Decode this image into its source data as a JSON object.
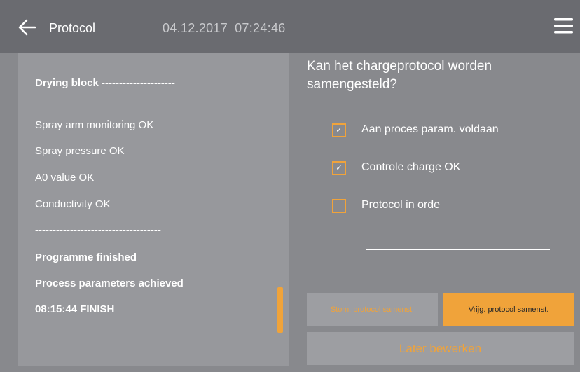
{
  "header": {
    "title": "Protocol",
    "date": "04.12.2017",
    "time": "07:24:46",
    "back_icon": "arrow-left-icon",
    "menu_icon": "hamburger-menu-icon"
  },
  "log": {
    "lines": [
      {
        "text": "Drying block ---------------------",
        "bold": true
      },
      {
        "text": "Spray arm monitoring OK",
        "bold": false
      },
      {
        "text": "Spray pressure OK",
        "bold": false
      },
      {
        "text": "A0 value OK",
        "bold": false
      },
      {
        "text": "Conductivity OK",
        "bold": false
      },
      {
        "text": "------------------------------------",
        "bold": true
      },
      {
        "text": "Programme finished",
        "bold": true
      },
      {
        "text": "Process parameters achieved",
        "bold": true
      },
      {
        "text": "08:15:44 FINISH",
        "bold": true
      }
    ]
  },
  "question": "Kan het chargeprotocol worden samengesteld?",
  "checklist": [
    {
      "label": "Aan proces param. voldaan",
      "checked": true
    },
    {
      "label": "Controle charge OK",
      "checked": true
    },
    {
      "label": "Protocol in orde",
      "checked": false
    }
  ],
  "buttons": {
    "storn": "Storn. protocol samenst.",
    "vrijg": "Vrijg. protocol samenst.",
    "later": "Later bewerken"
  },
  "colors": {
    "accent": "#f0a33a",
    "topbar": "#6a6b70",
    "background": "#88898d",
    "panel": "#97989c"
  }
}
